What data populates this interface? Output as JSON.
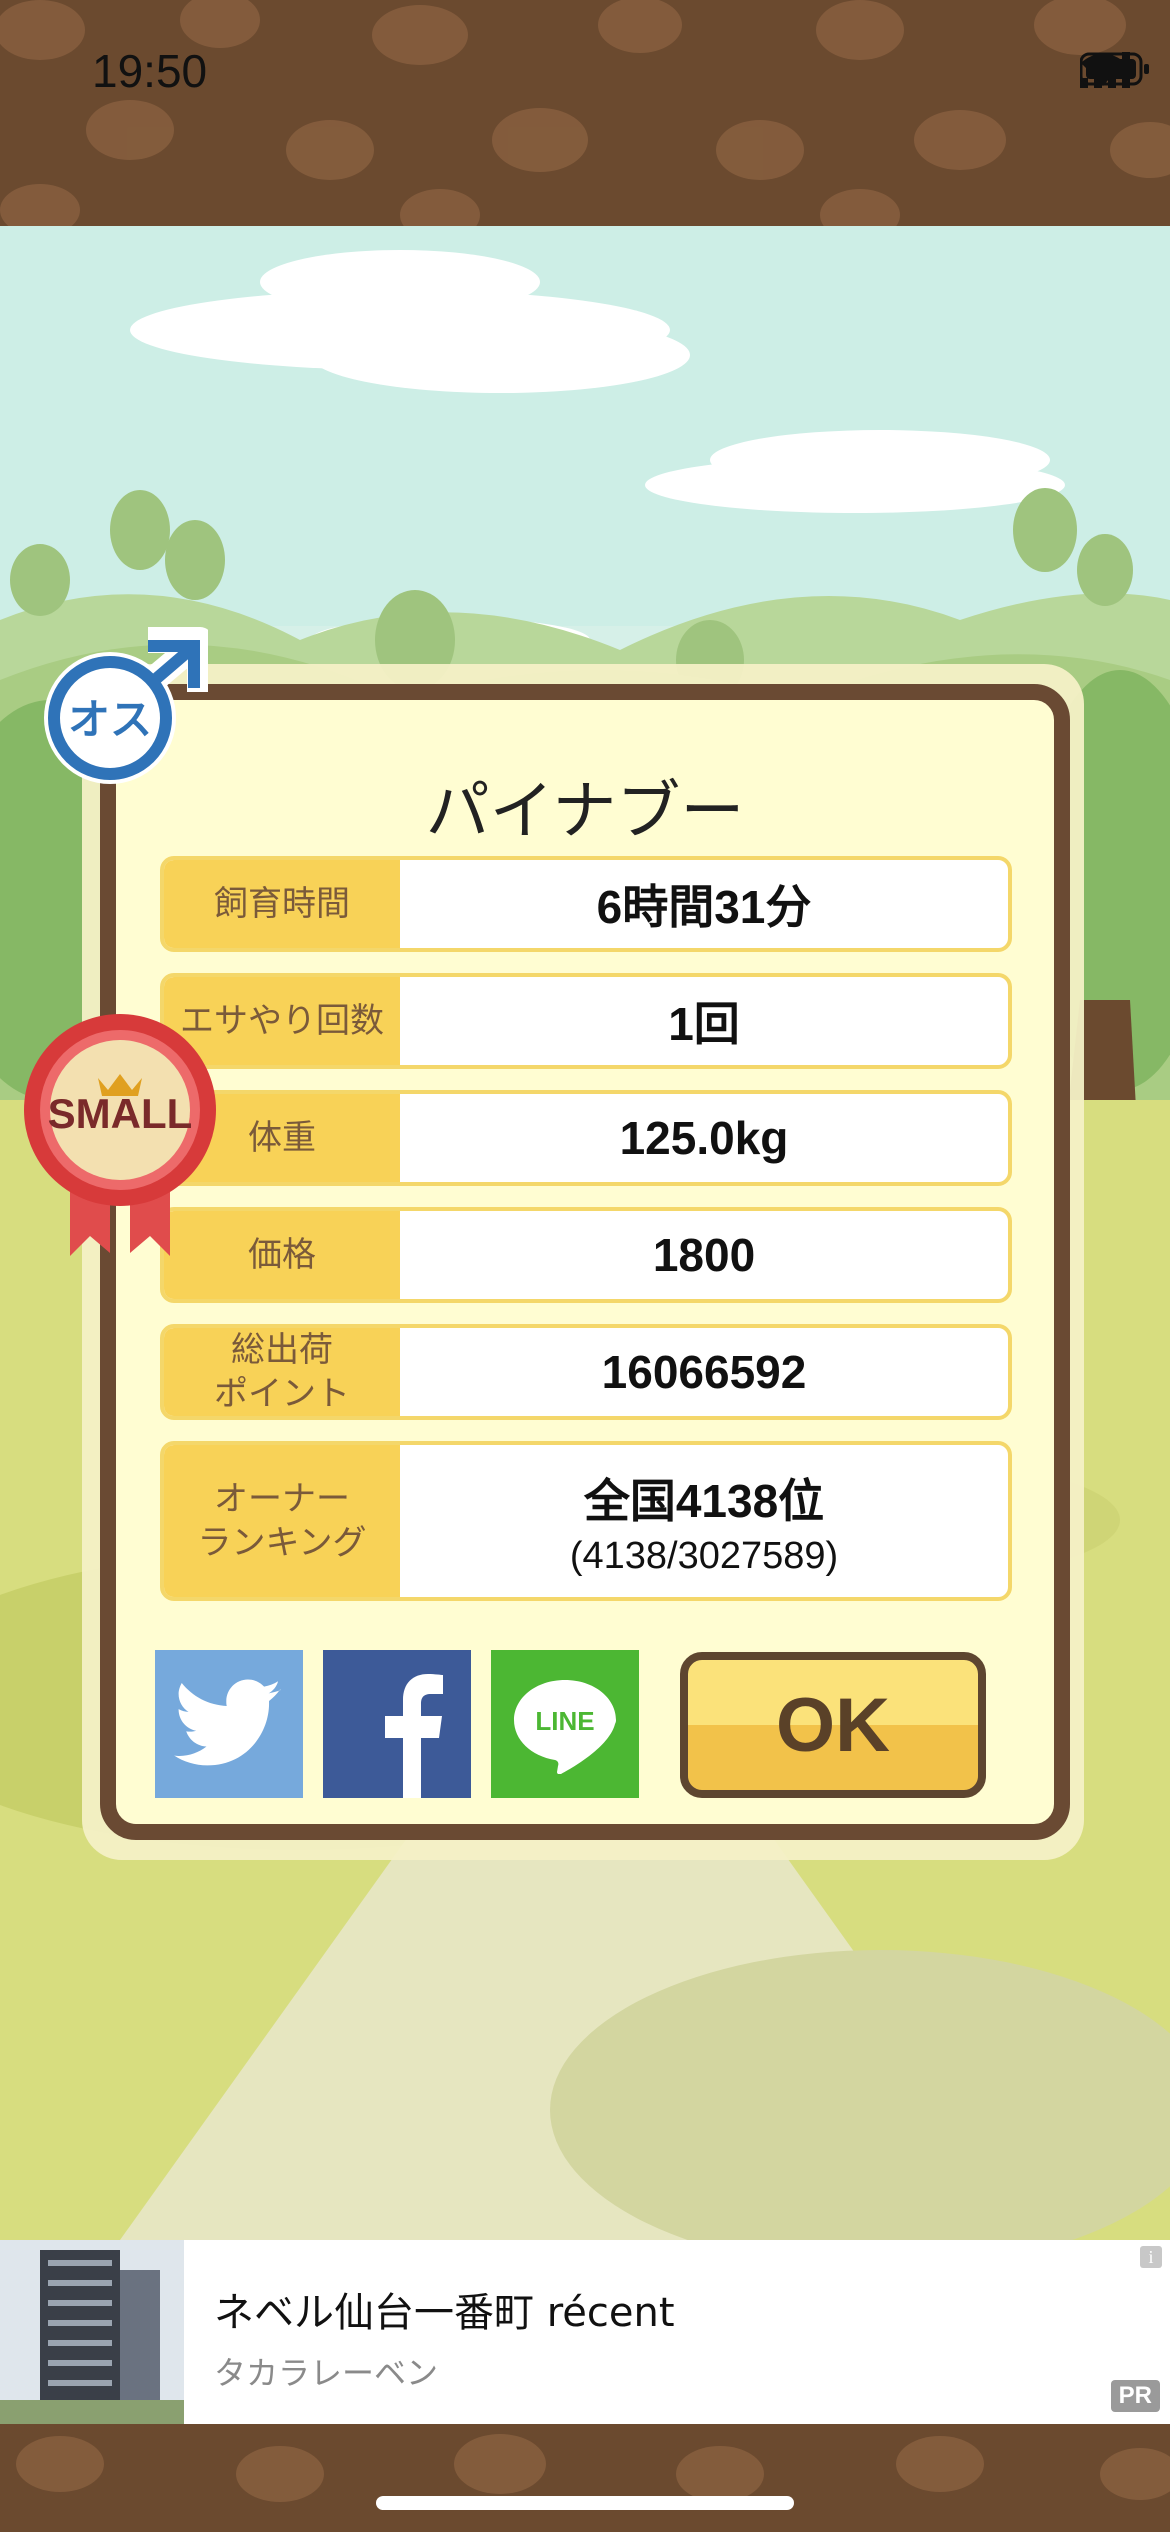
{
  "status_bar": {
    "time": "19:50"
  },
  "card": {
    "title": "パイナブー",
    "rows": [
      {
        "label": "飼育時間",
        "value": "6時間31分"
      },
      {
        "label": "エサやり回数",
        "value": "1回"
      },
      {
        "label": "体重",
        "value": "125.0kg"
      },
      {
        "label": "価格",
        "value": "1800"
      },
      {
        "label": "総出荷\nポイント",
        "value": "16066592"
      },
      {
        "label": "オーナー\nランキング",
        "value": "全国4138位",
        "sub": "(4138/3027589)"
      }
    ],
    "ok_label": "OK"
  },
  "badges": {
    "male": "オス",
    "size": "SMALL"
  },
  "share": {
    "line_label": "LINE"
  },
  "ad": {
    "title": "ネベル仙台一番町 récent",
    "subtitle": "タカラレーベン",
    "pr": "PR",
    "info": "i"
  },
  "colors": {
    "brown": "#6b4a2f",
    "card_border": "#6a4a33",
    "label_bg": "#f8d257",
    "ok_yellow": "#fbe27a"
  }
}
